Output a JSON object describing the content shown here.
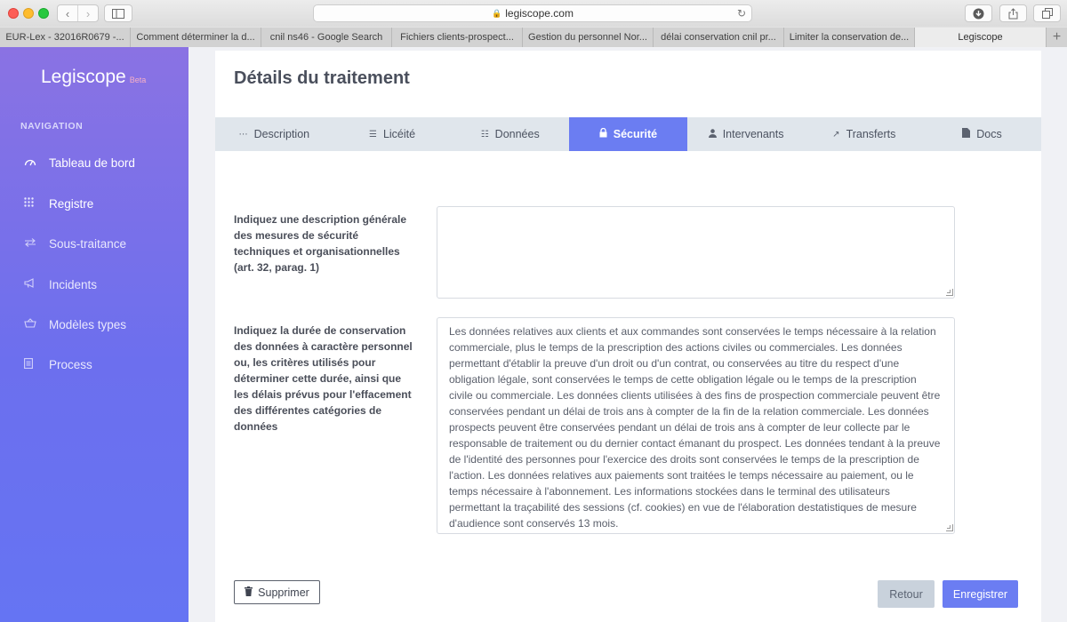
{
  "browser": {
    "url": "legiscope.com",
    "tabs": [
      "EUR-Lex - 32016R0679 -...",
      "Comment déterminer la d...",
      "cnil ns46 - Google Search",
      "Fichiers clients-prospect...",
      "Gestion du personnel Nor...",
      "délai conservation cnil pr...",
      "Limiter la conservation de...",
      "Legiscope"
    ],
    "active_tab_index": 7
  },
  "sidebar": {
    "brand": "Legiscope",
    "beta": "Beta",
    "nav_label": "NAVIGATION",
    "items": [
      {
        "label": "Tableau de bord",
        "icon": "gauge-icon"
      },
      {
        "label": "Registre",
        "icon": "grid-icon"
      },
      {
        "label": "Sous-traitance",
        "icon": "exchange-icon"
      },
      {
        "label": "Incidents",
        "icon": "megaphone-icon"
      },
      {
        "label": "Modèles types",
        "icon": "basket-icon"
      },
      {
        "label": "Process",
        "icon": "document-icon"
      }
    ]
  },
  "main": {
    "title": "Détails du traitement",
    "tabs": [
      {
        "label": "Description",
        "icon": "grid-icon"
      },
      {
        "label": "Licéité",
        "icon": "list-icon"
      },
      {
        "label": "Données",
        "icon": "database-icon"
      },
      {
        "label": "Sécurité",
        "icon": "lock-icon",
        "active": true
      },
      {
        "label": "Intervenants",
        "icon": "user-icon"
      },
      {
        "label": "Transferts",
        "icon": "arrow-up-right-icon"
      },
      {
        "label": "Docs",
        "icon": "file-icon"
      }
    ],
    "fields": {
      "security": {
        "label": "Indiquez une description générale des mesures de sécurité techniques et organisationnelles (art. 32, parag. 1)",
        "value": ""
      },
      "retention": {
        "label": "Indiquez la durée de conservation des données à caractère personnel ou, les critères utilisés pour déterminer cette durée, ainsi que les délais prévus pour l'effacement des différentes catégories de données",
        "value": "Les données relatives aux clients et aux commandes sont conservées le temps nécessaire à la relation commerciale, plus le temps de la prescription des actions civiles ou commerciales. Les données permettant d'établir la preuve d'un droit ou d'un contrat, ou conservées au titre du respect d'une obligation légale, sont conservées le temps de cette obligation légale ou le temps de la prescription civile ou commerciale. Les données clients utilisées à des fins de prospection commerciale peuvent être conservées pendant un délai de trois ans à compter de la fin de la relation commerciale. Les données prospects peuvent être conservées pendant un délai de trois ans à compter de leur collecte par le responsable de traitement ou du dernier contact émanant du prospect. Les données tendant à la preuve de l'identité des personnes pour l'exercice des droits sont conservées le temps de la prescription de l'action. Les données relatives aux paiements sont traitées le temps nécessaire au paiement, ou le temps nécessaire à l'abonnement. Les informations stockées dans le terminal des utilisateurs permettant la traçabilité des sessions (cf. cookies) en vue de l'élaboration destatistiques de mesure d'audience sont conservés 13 mois."
      }
    },
    "buttons": {
      "delete": "Supprimer",
      "back": "Retour",
      "save": "Enregistrer"
    }
  },
  "colors": {
    "accent": "#6b7df2",
    "sidebar_top": "#8a72e3",
    "sidebar_bottom": "#6574f3",
    "tabbar": "#e0e6ec"
  }
}
